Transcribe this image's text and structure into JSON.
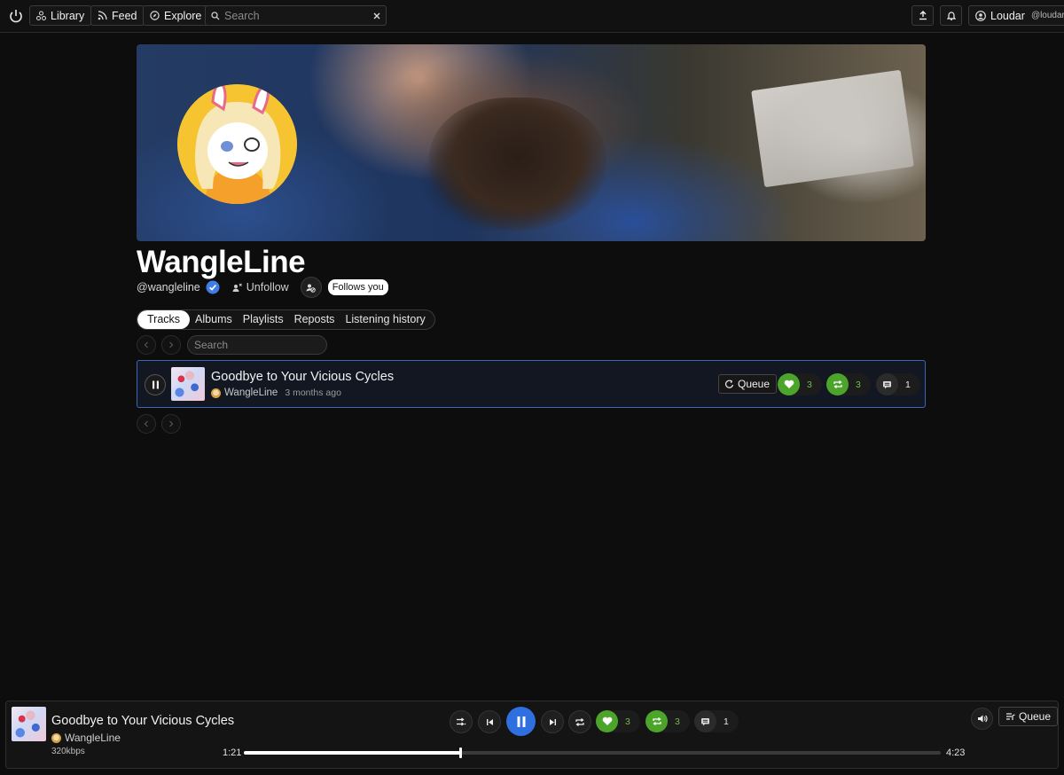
{
  "topbar": {
    "logo_icon": "power-icon",
    "library_label": "Library",
    "feed_label": "Feed",
    "explore_label": "Explore",
    "search_placeholder": "Search",
    "upload_icon": "upload-icon",
    "bell_icon": "bell-icon",
    "user_name": "Loudar",
    "user_handle": "@loudar"
  },
  "profile": {
    "name": "WangleLine",
    "handle": "@wangleline",
    "verified": true,
    "unfollow_label": "Unfollow",
    "follows_you_label": "Follows you"
  },
  "tabs": [
    {
      "label": "Tracks",
      "active": true
    },
    {
      "label": "Albums",
      "active": false
    },
    {
      "label": "Playlists",
      "active": false
    },
    {
      "label": "Reposts",
      "active": false
    },
    {
      "label": "Listening history",
      "active": false
    }
  ],
  "list": {
    "search_placeholder": "Search"
  },
  "tracks": [
    {
      "title": "Goodbye to Your Vicious Cycles",
      "artist": "WangleLine",
      "time_ago": "3 months ago",
      "queue_label": "Queue",
      "likes": "3",
      "reposts": "3",
      "comments": "1",
      "playing": true
    }
  ],
  "player": {
    "title": "Goodbye to Your Vicious Cycles",
    "artist": "WangleLine",
    "bitrate": "320kbps",
    "current_time": "1:21",
    "total_time": "4:23",
    "progress": 0.31,
    "likes": "3",
    "reposts": "3",
    "comments": "1",
    "queue_label": "Queue"
  },
  "colors": {
    "accent_blue": "#2f6fe0",
    "like_green": "#4ca52a",
    "avatar_yellow": "#f7c431"
  }
}
